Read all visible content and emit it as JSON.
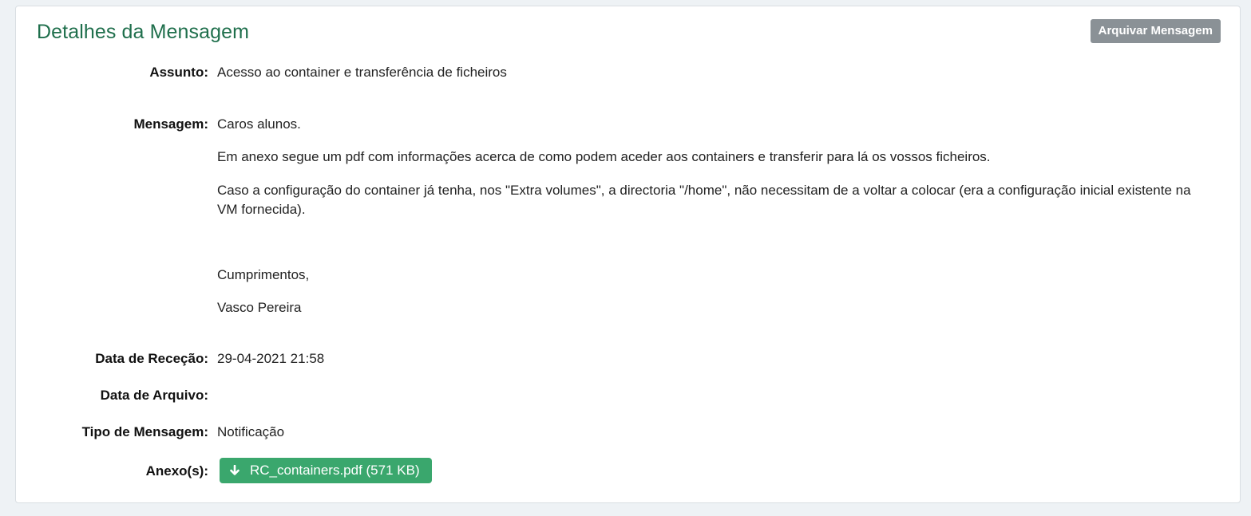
{
  "panel": {
    "title": "Detalhes da Mensagem",
    "archive_button": "Arquivar Mensagem"
  },
  "fields": {
    "subject": {
      "label": "Assunto:",
      "value": "Acesso ao container e transferência de ficheiros"
    },
    "message": {
      "label": "Mensagem:",
      "paragraphs": [
        "Caros alunos.",
        "Em anexo segue um pdf com informações acerca de como podem aceder aos containers e transferir para lá os vossos ficheiros.",
        "Caso a configuração do container já tenha, nos \"Extra volumes\", a directoria \"/home\", não necessitam de a voltar a colocar (era a configuração inicial existente na VM fornecida).",
        "Cumprimentos,",
        "Vasco Pereira"
      ]
    },
    "received_date": {
      "label": "Data de Receção:",
      "value": "29-04-2021 21:58"
    },
    "archive_date": {
      "label": "Data de Arquivo:",
      "value": ""
    },
    "message_type": {
      "label": "Tipo de Mensagem:",
      "value": "Notificação"
    },
    "attachments": {
      "label": "Anexo(s):",
      "items": [
        {
          "name": "RC_containers.pdf (571 KB)",
          "icon": "download-arrow-icon"
        }
      ]
    }
  },
  "colors": {
    "title": "#1f6f4c",
    "archive_button": "#8a9196",
    "attachment_button": "#3aa76d"
  }
}
